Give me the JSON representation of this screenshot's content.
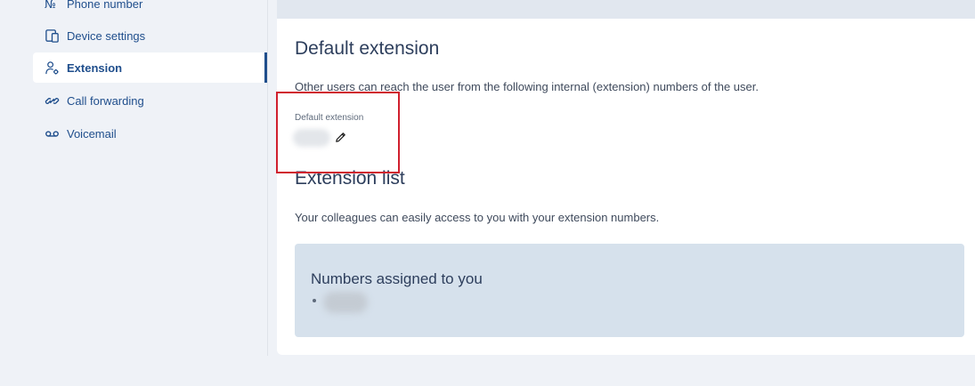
{
  "sidebar": {
    "items": [
      {
        "label": "Phone number",
        "icon": "phone-number-icon"
      },
      {
        "label": "Device settings",
        "icon": "device-settings-icon"
      },
      {
        "label": "Extension",
        "icon": "user-gear-icon",
        "active": true
      },
      {
        "label": "Call forwarding",
        "icon": "call-forwarding-icon"
      },
      {
        "label": "Voicemail",
        "icon": "voicemail-icon"
      }
    ]
  },
  "main": {
    "default_extension": {
      "title": "Default extension",
      "description": "Other users can reach the user from the following internal (extension) numbers of the user.",
      "field_label": "Default extension"
    },
    "extension_list": {
      "title": "Extension list",
      "description": "Your colleagues can easily access to you with your extension numbers.",
      "assigned_title": "Numbers assigned to you"
    }
  },
  "colors": {
    "accent": "#1f4e8c",
    "highlight": "#d0202e",
    "assigned_bg": "#d6e1ec"
  }
}
